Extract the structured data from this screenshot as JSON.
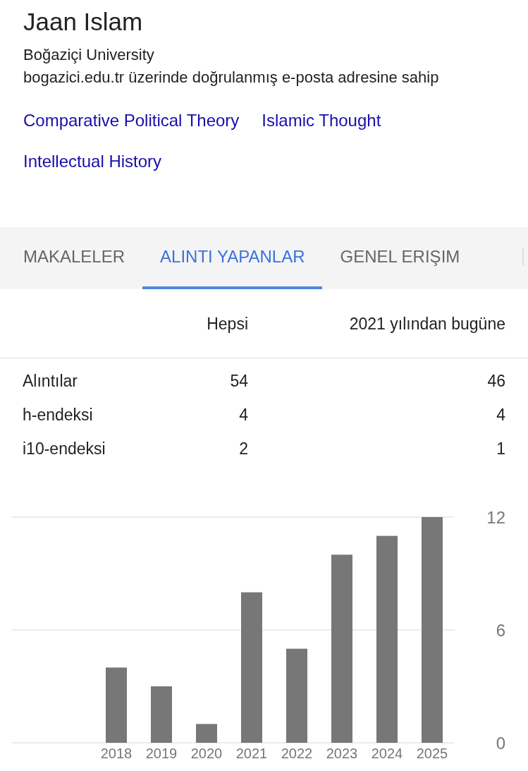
{
  "profile": {
    "name": "Jaan Islam",
    "affiliation": "Boğaziçi University",
    "email_note": "bogazici.edu.tr üzerinde doğrulanmış e-posta adresine sahip",
    "interests": [
      "Comparative Political Theory",
      "Islamic Thought",
      "Intellectual History"
    ]
  },
  "tabs": [
    {
      "label": "MAKALELER",
      "selected": false
    },
    {
      "label": "ALINTI YAPANLAR",
      "selected": true
    },
    {
      "label": "GENEL ERIŞIM",
      "selected": false
    }
  ],
  "citations": {
    "columns": [
      "Hepsi",
      "2021 yılından bugüne"
    ],
    "rows": [
      {
        "label": "Alıntılar",
        "all": "54",
        "since": "46"
      },
      {
        "label": "h-endeksi",
        "all": "4",
        "since": "4"
      },
      {
        "label": "i10-endeksi",
        "all": "2",
        "since": "1"
      }
    ],
    "chart_data": {
      "type": "bar",
      "categories": [
        "2018",
        "2019",
        "2020",
        "2021",
        "2022",
        "2023",
        "2024",
        "2025"
      ],
      "values": [
        4,
        3,
        1,
        8,
        5,
        10,
        11,
        12
      ],
      "ylim": [
        0,
        12
      ],
      "yticks": [
        0,
        6,
        12
      ]
    }
  }
}
